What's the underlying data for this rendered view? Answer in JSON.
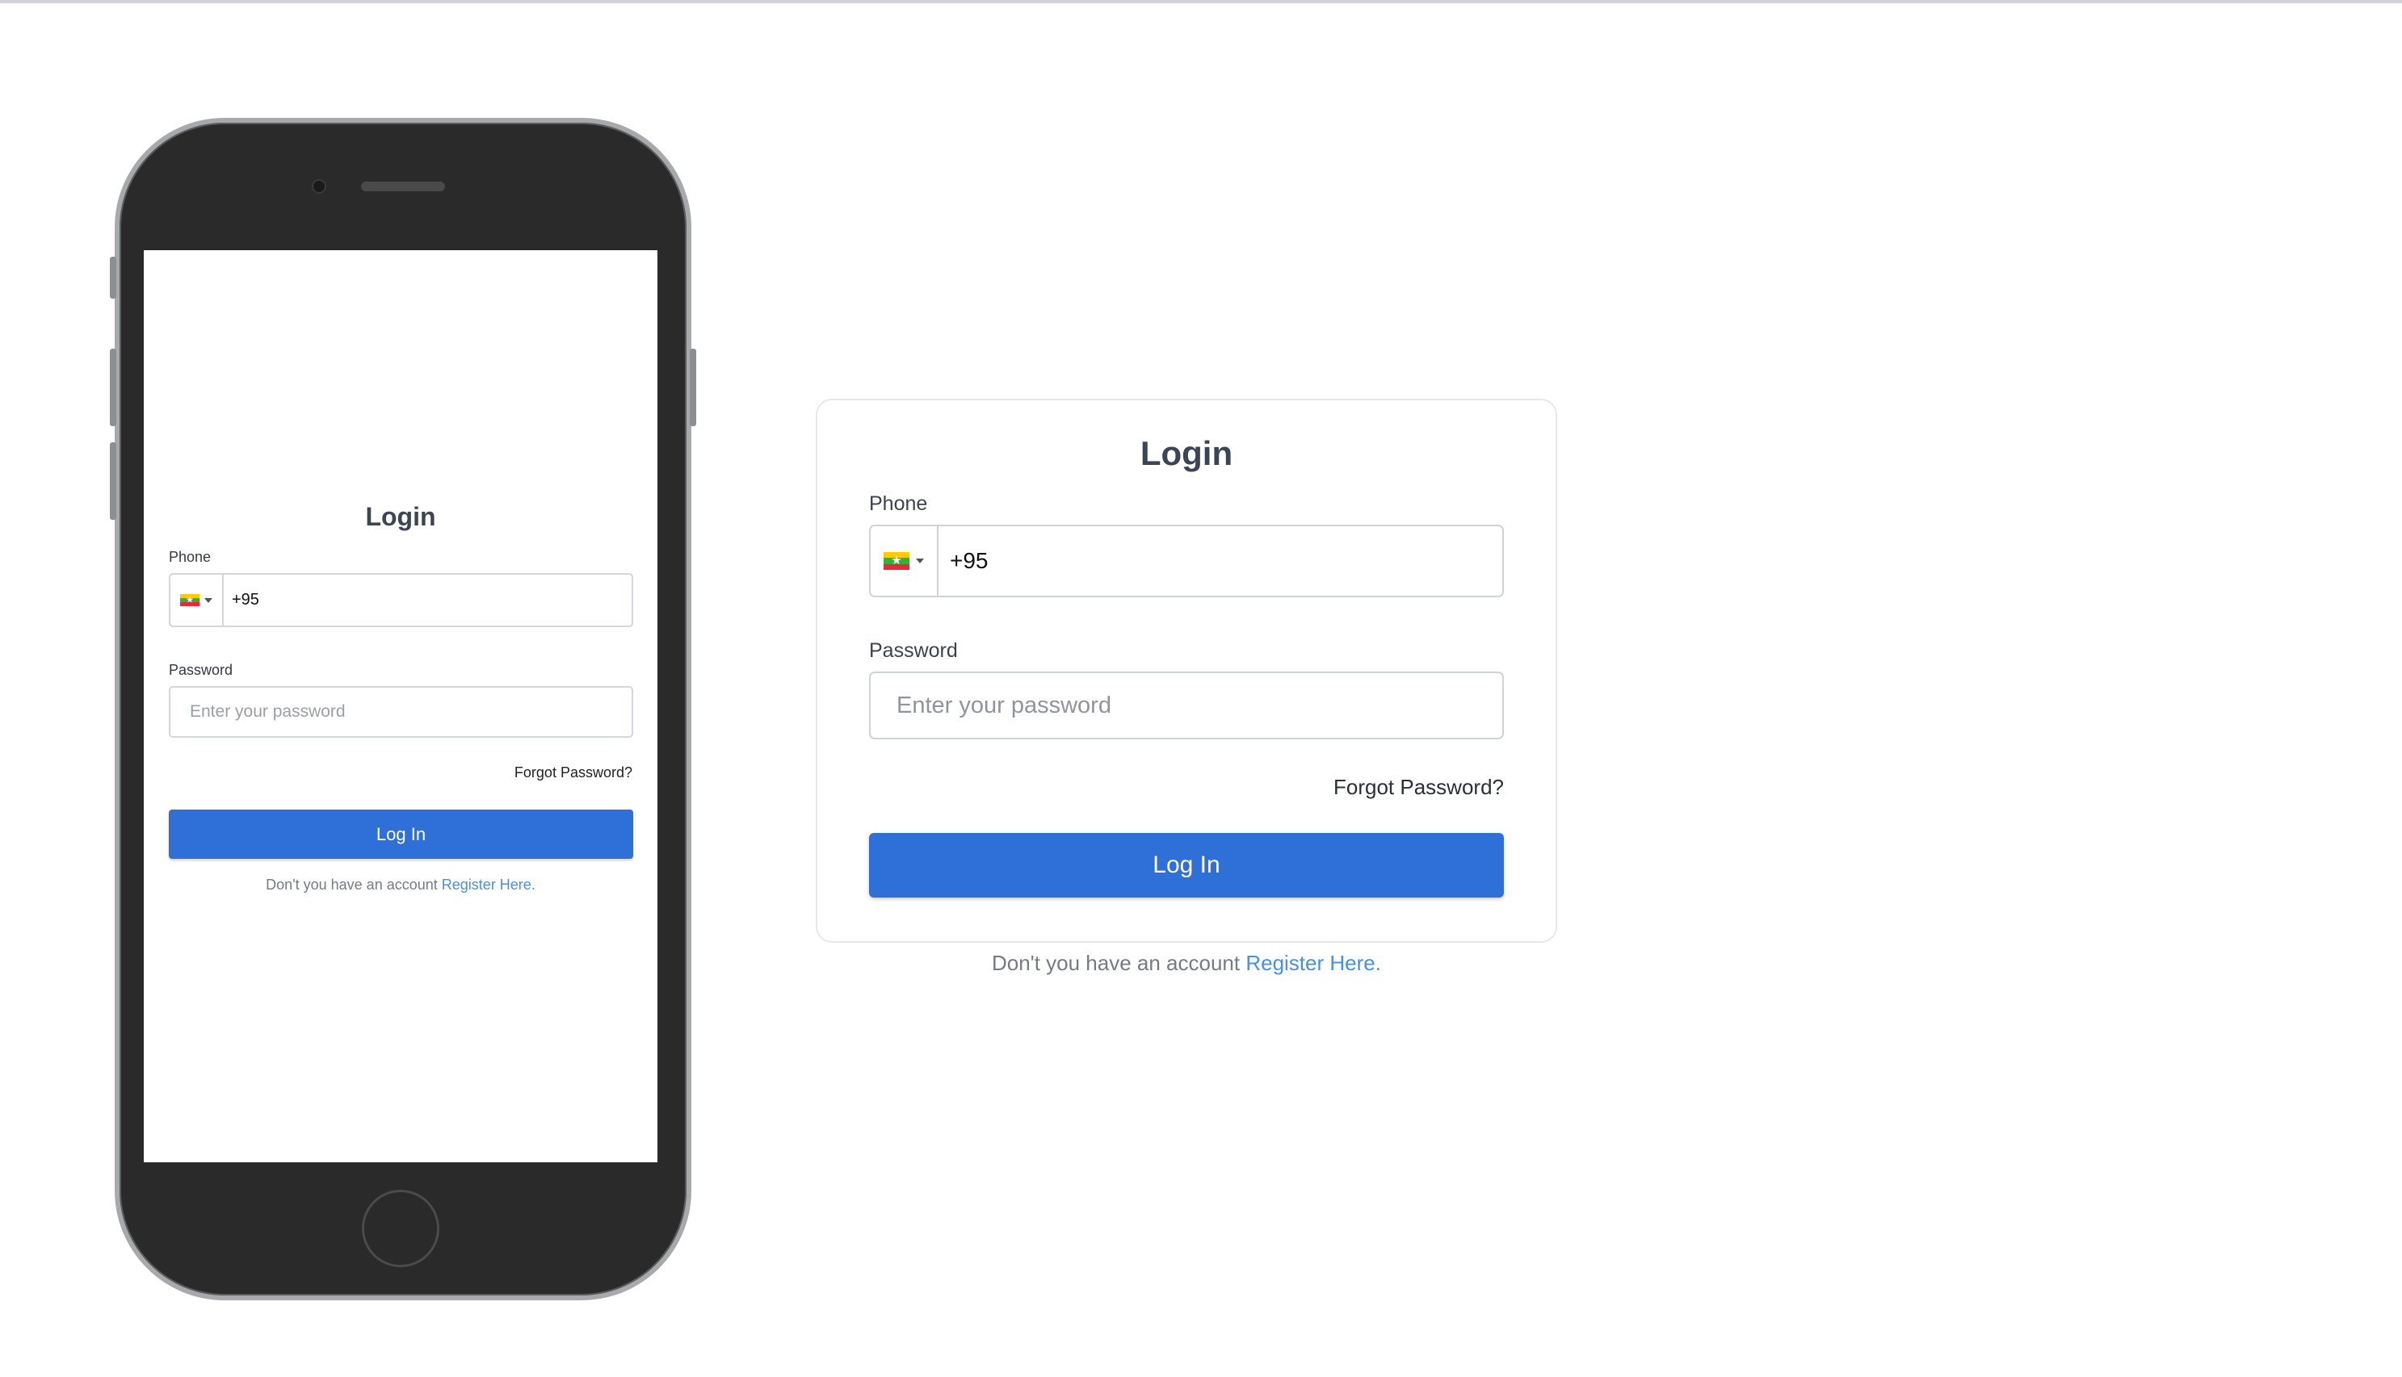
{
  "mobile": {
    "title": "Login",
    "phone_label": "Phone",
    "phone_value": "+95",
    "country_flag": "myanmar-flag-icon",
    "password_label": "Password",
    "password_placeholder": "Enter your password",
    "forgot_password": "Forgot Password?",
    "login_button": "Log In",
    "register_prompt": "Don't you have an account",
    "register_link": "Register Here",
    "register_suffix": "."
  },
  "desktop": {
    "title": "Login",
    "phone_label": "Phone",
    "phone_value": "+95",
    "country_flag": "myanmar-flag-icon",
    "password_label": "Password",
    "password_placeholder": "Enter your password",
    "forgot_password": "Forgot Password?",
    "login_button": "Log In",
    "register_prompt": "Don't you have an account",
    "register_link": "Register Here",
    "register_suffix": "."
  },
  "colors": {
    "primary_button": "#2f6fd8",
    "link": "#4a8fe0",
    "title_text": "#3b4556",
    "phone_frame": "#2a2a2a"
  }
}
